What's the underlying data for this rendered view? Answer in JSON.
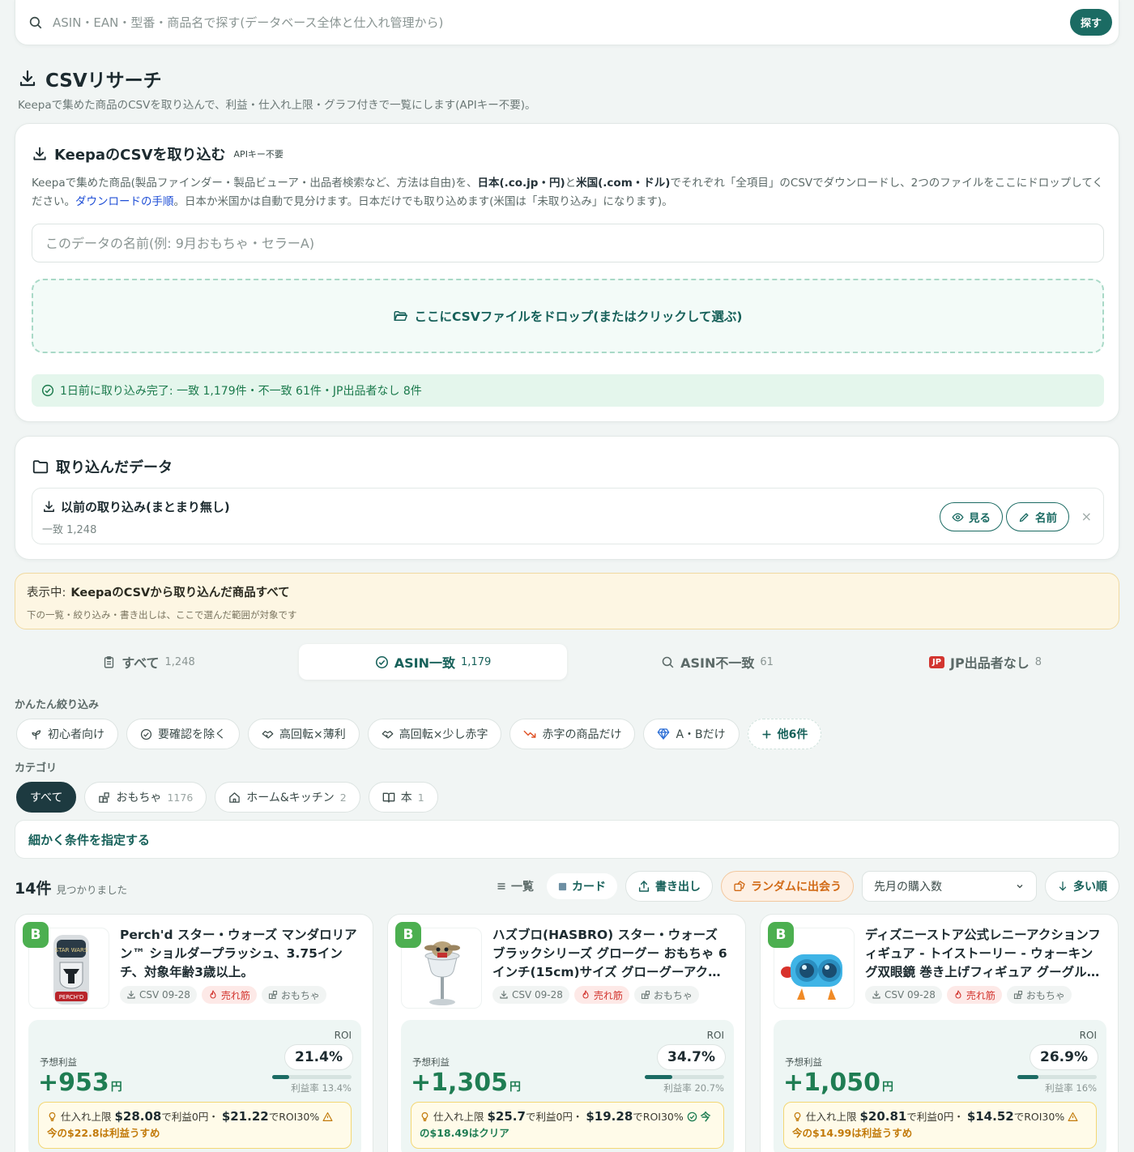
{
  "search": {
    "placeholder": "ASIN・EAN・型番・商品名で探す(データベース全体と仕入れ管理から)",
    "button": "探す"
  },
  "page": {
    "title": "CSVリサーチ",
    "description": "Keepaで集めた商品のCSVを取り込んで、利益・仕入れ上限・グラフ付きで一覧にします(APIキー不要)。"
  },
  "import": {
    "title": "KeepaのCSVを取り込む",
    "badge": "APIキー不要",
    "desc_1": "Keepaで集めた商品(製品ファインダー・製品ビューア・出品者検索など、方法は自由)を、",
    "desc_jp": "日本(.co.jp・円)",
    "desc_and": "と",
    "desc_us": "米国(.com・ドル)",
    "desc_2": "でそれぞれ「全項目」のCSVでダウンロードし、2つのファイルをここにドロップしてください。",
    "desc_link": "ダウンロードの手順",
    "desc_3": "。日本か米国かは自動で見分けます。日本だけでも取り込めます(米国は「未取り込み」になります)。",
    "name_placeholder": "このデータの名前(例: 9月おもちゃ・セラーA)",
    "dropzone": "ここにCSVファイルをドロップ(またはクリックして選ぶ)",
    "status": "1日前に取り込み完了: 一致 1,179件・不一致 61件・JP出品者なし 8件"
  },
  "imported": {
    "title": "取り込んだデータ",
    "item_title": "以前の取り込み(まとまり無し)",
    "item_count": "一致 1,248",
    "view_button": "見る",
    "rename_button": "名前",
    "close": "×"
  },
  "showing": {
    "label": "表示中:",
    "value": "KeepaのCSVから取り込んだ商品すべて",
    "sub": "下の一覧・絞り込み・書き出しは、ここで選んだ範囲が対象です"
  },
  "tabs": [
    {
      "label": "すべて",
      "count": "1,248"
    },
    {
      "label": "ASIN一致",
      "count": "1,179"
    },
    {
      "label": "ASIN不一致",
      "count": "61"
    },
    {
      "label": "JP出品者なし",
      "count": "8",
      "badge": "JP"
    }
  ],
  "quick_filter": {
    "label": "かんたん絞り込み",
    "chips": [
      "初心者向け",
      "要確認を除く",
      "高回転×薄利",
      "高回転×少し赤字",
      "赤字の商品だけ",
      "A・Bだけ"
    ],
    "more": "他6件"
  },
  "category": {
    "label": "カテゴリ",
    "items": [
      {
        "label": "すべて",
        "count": ""
      },
      {
        "label": "おもちゃ",
        "count": "1176"
      },
      {
        "label": "ホーム&キッチン",
        "count": "2"
      },
      {
        "label": "本",
        "count": "1"
      }
    ]
  },
  "detail_filter": "細かく条件を指定する",
  "results": {
    "count": "14件",
    "suffix": "見つかりました"
  },
  "toolbar": {
    "list": "一覧",
    "card": "カード",
    "export": "書き出し",
    "random": "ランダムに出会う",
    "sort": "先月の購入数",
    "order": "多い順"
  },
  "products": [
    {
      "grade": "B",
      "title": "Perch'd スター・ウォーズ マンダロリアン™ ショルダープラッシュ、3.75インチ、対象年齢3歳以上。",
      "csv": "CSV 09-28",
      "hot": "売れ筋",
      "category": "おもちゃ",
      "roi_label": "ROI",
      "roi": "21.4%",
      "roi_frac": 0.214,
      "profit_label": "予想利益",
      "profit": "+953",
      "yen": "円",
      "margin": "利益率 13.4%",
      "limit_label": "仕入れ上限",
      "limit_zero": "$28.08",
      "limit_zero_txt": "で利益0円・",
      "limit_roi": "$21.22",
      "limit_roi_txt": "でROI30%",
      "note": "今の$22.8は利益うすめ",
      "note_type": "warn"
    },
    {
      "grade": "B",
      "title": "ハズブロ(HASBRO) スター・ウォーズ ブラックシリーズ グローグー おもちゃ 6インチ(15cm)サイズ グローグーアクションフィギュア",
      "csv": "CSV 09-28",
      "hot": "売れ筋",
      "category": "おもちゃ",
      "roi_label": "ROI",
      "roi": "34.7%",
      "roi_frac": 0.347,
      "profit_label": "予想利益",
      "profit": "+1,305",
      "yen": "円",
      "margin": "利益率 20.7%",
      "limit_label": "仕入れ上限",
      "limit_zero": "$25.7",
      "limit_zero_txt": "で利益0円・",
      "limit_roi": "$19.28",
      "limit_roi_txt": "でROI30%",
      "note": "今の$18.49はクリア",
      "note_type": "ok"
    },
    {
      "grade": "B",
      "title": "ディズニーストア公式レニーアクションフィギュア - トイストーリー - ウォーキング双眼鏡 巻き上げフィギュア グーグルアイズ",
      "csv": "CSV 09-28",
      "hot": "売れ筋",
      "category": "おもちゃ",
      "roi_label": "ROI",
      "roi": "26.9%",
      "roi_frac": 0.269,
      "profit_label": "予想利益",
      "profit": "+1,050",
      "yen": "円",
      "margin": "利益率 16%",
      "limit_label": "仕入れ上限",
      "limit_zero": "$20.81",
      "limit_zero_txt": "で利益0円・",
      "limit_roi": "$14.52",
      "limit_roi_txt": "でROI30%",
      "note": "今の$14.99は利益うすめ",
      "note_type": "warn"
    }
  ],
  "colors": {
    "accent": "#1b6b63",
    "profit": "#1f7d53",
    "hot": "#d2352f",
    "warn": "#c27a0a",
    "grade_b": "#4caf50"
  }
}
